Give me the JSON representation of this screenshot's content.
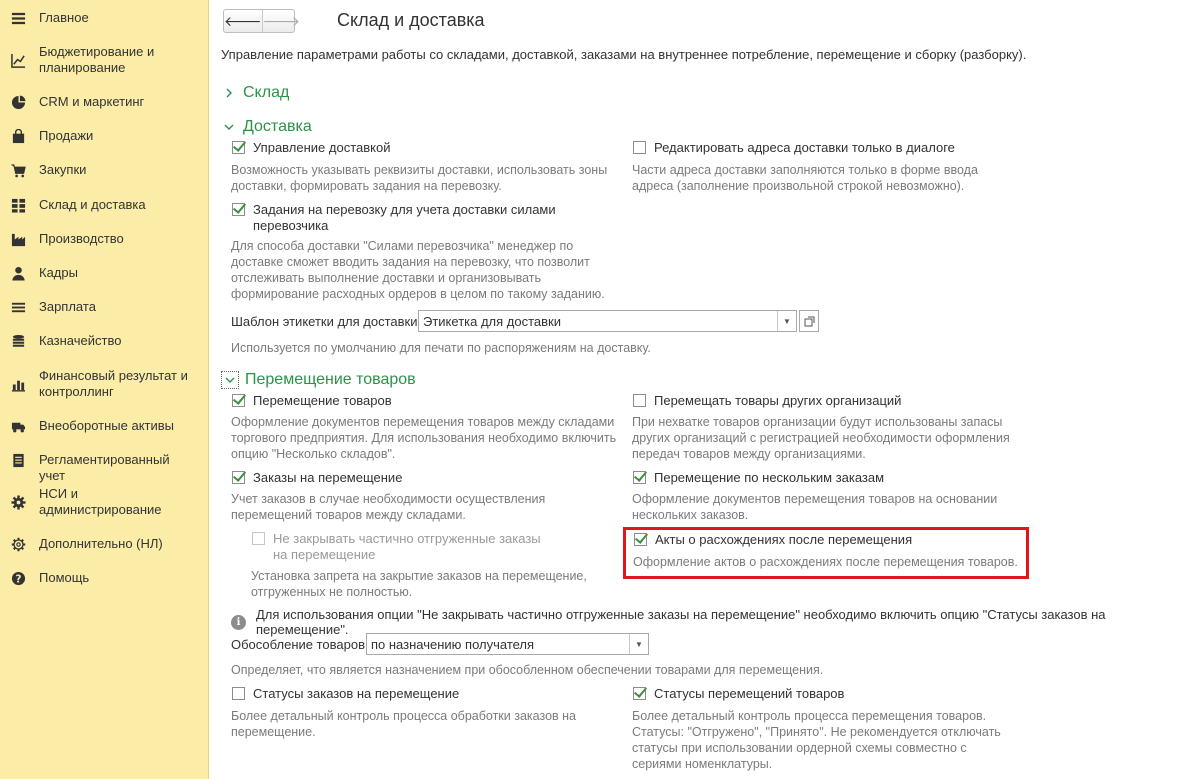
{
  "sidebar": {
    "items": [
      {
        "label": "Главное",
        "icon": "menu-icon"
      },
      {
        "label": "Бюджетирование и планирование",
        "icon": "chart-line-icon"
      },
      {
        "label": "CRM и маркетинг",
        "icon": "pie-chart-icon"
      },
      {
        "label": "Продажи",
        "icon": "shopping-bag-icon"
      },
      {
        "label": "Закупки",
        "icon": "cart-icon"
      },
      {
        "label": "Склад и доставка",
        "icon": "warehouse-grid-icon"
      },
      {
        "label": "Производство",
        "icon": "factory-icon"
      },
      {
        "label": "Кадры",
        "icon": "person-icon"
      },
      {
        "label": "Зарплата",
        "icon": "wallet-icon"
      },
      {
        "label": "Казначейство",
        "icon": "coins-icon"
      },
      {
        "label": "Финансовый результат и контроллинг",
        "icon": "bar-chart-icon"
      },
      {
        "label": "Внеоборотные активы",
        "icon": "truck-icon"
      },
      {
        "label": "Регламентированный учет",
        "icon": "document-icon"
      },
      {
        "label": "НСИ и администрирование",
        "icon": "gear-icon"
      },
      {
        "label": "Дополнительно (НЛ)",
        "icon": "gear-outline-icon"
      },
      {
        "label": "Помощь",
        "icon": "help-icon"
      }
    ]
  },
  "header": {
    "back": "🡐",
    "forward": "🡒",
    "title": "Склад и доставка",
    "subtitle": "Управление параметрами работы со складами, доставкой, заказами на внутреннее потребление, перемещение и сборку (разборку)."
  },
  "groups": {
    "sklad": "Склад",
    "dostavka": "Доставка",
    "peremeshchenie": "Перемещение товаров"
  },
  "delivery": {
    "manage_label": "Управление доставкой",
    "manage_hint": "Возможность указывать реквизиты доставки, использовать зоны доставки, формировать задания на перевозку.",
    "edit_addr_label": "Редактировать адреса доставки только в диалоге",
    "edit_addr_hint": "Части адреса доставки заполняются только в форме ввода адреса (заполнение произвольной строкой невозможно).",
    "tasks_label": "Задания на перевозку для учета доставки силами перевозчика",
    "tasks_hint": "Для способа доставки \"Силами перевозчика\" менеджер по доставке сможет вводить задания на перевозку, что позволит отслеживать выполнение доставки и организовывать формирование расходных ордеров в целом по такому заданию.",
    "template_label": "Шаблон этикетки для доставки:",
    "template_value": "Этикетка для доставки",
    "template_hint": "Используется по умолчанию для печати по распоряжениям на доставку."
  },
  "transfer": {
    "transfer_label": "Перемещение товаров",
    "transfer_hint": "Оформление документов перемещения товаров между складами торгового предприятия. Для использования необходимо включить опцию \"Несколько складов\".",
    "other_org_label": "Перемещать товары других организаций",
    "other_org_hint": "При нехватке товаров организации будут использованы запасы других организаций с регистрацией необходимости оформления передач товаров между организациями.",
    "orders_label": "Заказы на перемещение",
    "orders_hint": "Учет заказов в случае необходимости осуществления перемещений товаров между складами.",
    "multi_orders_label": "Перемещение по нескольким заказам",
    "multi_orders_hint": "Оформление документов перемещения товаров на основании нескольких заказов.",
    "no_close_label": "Не закрывать частично отгруженные заказы на перемещение",
    "no_close_hint": "Установка запрета на закрытие заказов на перемещение, отгруженных не полностью.",
    "acts_label": "Акты о расхождениях после перемещения",
    "acts_hint": "Оформление актов о расхождениях после перемещения товаров.",
    "info_text": "Для использования опции \"Не закрывать частично отгруженные заказы на перемещение\" необходимо включить опцию \"Статусы заказов на перемещение\".",
    "isolation_label": "Обособление товаров:",
    "isolation_value": "по назначению получателя",
    "isolation_hint": "Определяет, что является назначением при обособленном обеспечении товарами для перемещения.",
    "order_status_label": "Статусы заказов на перемещение",
    "order_status_hint": "Более детальный контроль процесса обработки заказов на перемещение.",
    "transfer_status_label": "Статусы перемещений товаров",
    "transfer_status_hint": "Более детальный контроль процесса перемещения товаров. Статусы: \"Отгружено\", \"Принято\". Не рекомендуется отключать статусы при использовании ордерной схемы совместно с сериями номенклатуры."
  },
  "colors": {
    "sidebar_bg": "#fbeda8",
    "group_green": "#2b9348",
    "highlight_red": "#e0161b"
  }
}
